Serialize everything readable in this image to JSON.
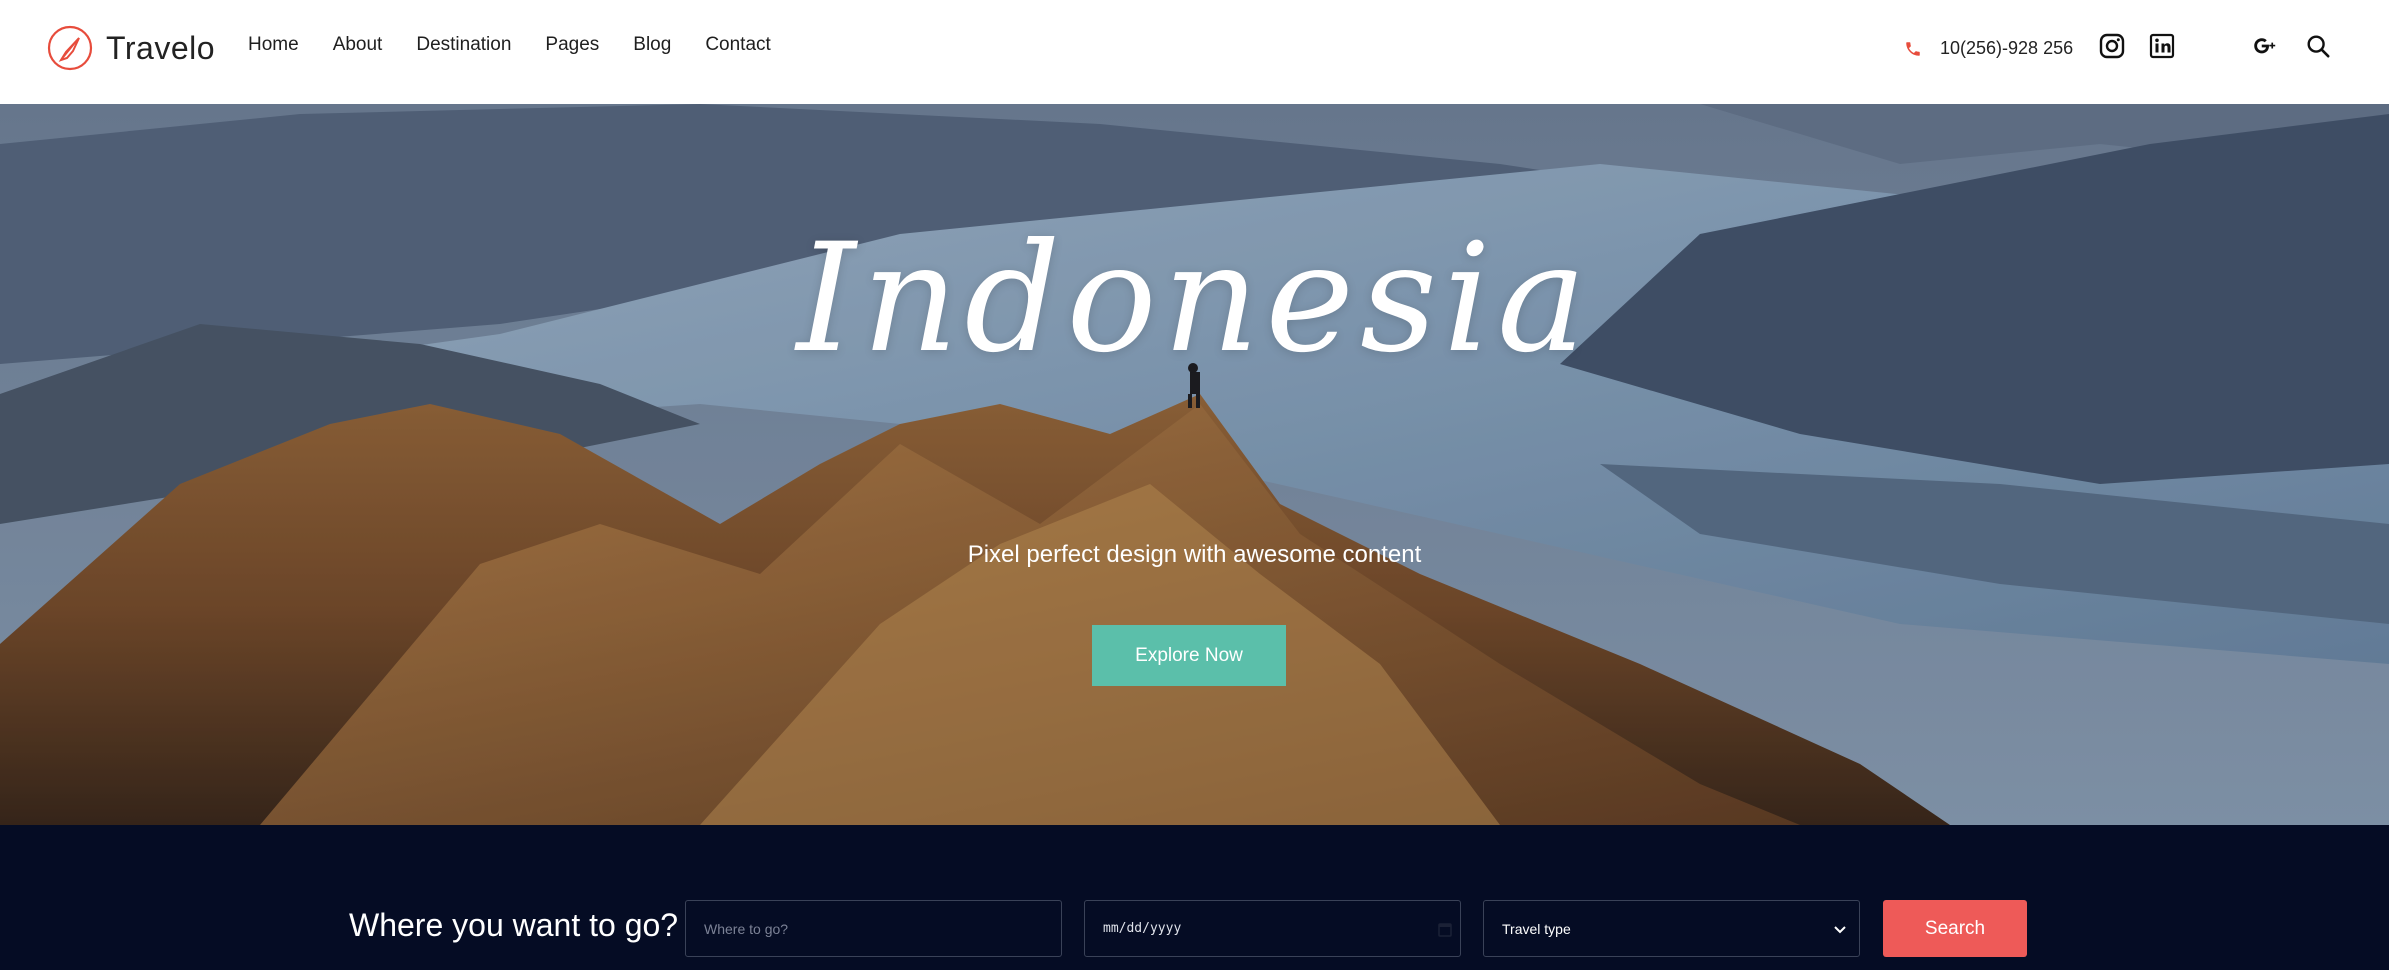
{
  "brand": {
    "name": "Travelo",
    "accent": "#e74c3c"
  },
  "nav": {
    "items": [
      "Home",
      "About",
      "Destination",
      "Pages",
      "Blog",
      "Contact"
    ]
  },
  "contact": {
    "phone": "10(256)-928 256"
  },
  "social": [
    "instagram-icon",
    "linkedin-icon",
    "google-plus-icon"
  ],
  "hero": {
    "title": "Indonesia",
    "subtitle": "Pixel perfect design with awesome content",
    "cta_label": "Explore Now",
    "cta_color": "#5bbfaa"
  },
  "search": {
    "heading": "Where you want to go?",
    "where_placeholder": "Where to go?",
    "date_placeholder": "mm/dd/yyyy",
    "type_selected": "Travel type",
    "button_label": "Search",
    "button_color": "#ee5a58",
    "band_color": "#050c24"
  }
}
